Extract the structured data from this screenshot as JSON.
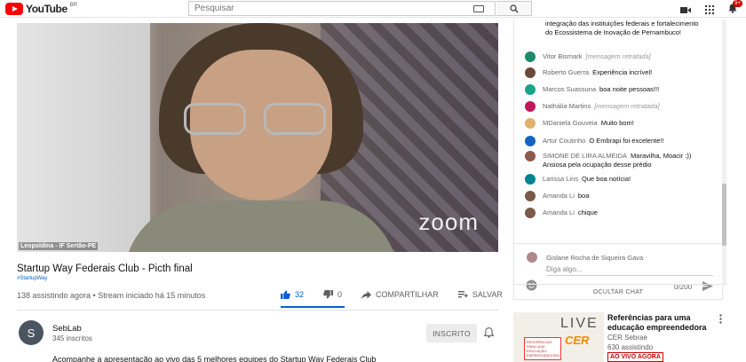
{
  "header": {
    "logo_text": "YouTube",
    "region": "BR",
    "search_placeholder": "Pesquisar",
    "notifications": "9+"
  },
  "video": {
    "speaker": "Leopoldina - IF Sertão-PE",
    "watermark": "zoom",
    "title": "Startup Way Federais Club - Picth final",
    "hashtag": "#StartupWay",
    "meta": "138 assistindo agora • Stream iniciado há 15 minutos",
    "likes": "32",
    "dislikes": "0",
    "like_fraction": 1.0,
    "share_label": "COMPARTILHAR",
    "save_label": "SALVAR"
  },
  "channel": {
    "initial": "S",
    "name": "SebLab",
    "subs": "345 inscritos",
    "subscribe_label": "INSCRITO",
    "description": "Acompanhe a apresentação ao vivo das 5 melhores equipes do Startup Way Federais Club"
  },
  "chat": {
    "first_message": "integração das instituições federais e fortalecimento do Ecossistema de Inovação de Pernambuco!",
    "messages": [
      {
        "author": "Vitor Bismark",
        "text": "[mensagem retratada]",
        "retracted": true,
        "color": "#1e8a6a"
      },
      {
        "author": "Roberto Guerra",
        "text": "Experiência incrível!",
        "retracted": false,
        "color": "#6b4a3a"
      },
      {
        "author": "Marcos Suassuna",
        "text": "boa noite pessoas!!!",
        "retracted": false,
        "color": "#1aa38a"
      },
      {
        "author": "Nathália Martins",
        "text": "[mensagem retratada]",
        "retracted": true,
        "color": "#c2185b"
      },
      {
        "author": "MDaniela Gouveia",
        "text": "Muito bom!",
        "retracted": false,
        "color": "#e0b070"
      },
      {
        "author": "Artur Coutinho",
        "text": "O Embrapi foi excelente!!",
        "retracted": false,
        "color": "#1565c0"
      },
      {
        "author": "SIMONE DE LIRA ALMEIDA",
        "text": "Maravilha, Moacir :)) Ansiosa pela ocupação desse prédio",
        "retracted": false,
        "color": "#8a5a4a"
      },
      {
        "author": "Larissa Lins",
        "text": "Que boa notícia!",
        "retracted": false,
        "color": "#00838f"
      },
      {
        "author": "Amanda Li",
        "text": "boa",
        "retracted": false,
        "color": "#7a5a4a"
      },
      {
        "author": "Amanda Li",
        "text": "chique",
        "retracted": false,
        "color": "#7a5a4a"
      }
    ],
    "composer_name": "Gislane Rocha de Siqueira Gava",
    "composer_placeholder": "Diga algo...",
    "char_count": "0/200",
    "hide_label": "OCULTAR CHAT"
  },
  "recommendation": {
    "thumb_live": "LIVE",
    "thumb_cer": "CER",
    "thumb_book": "REFERÊNCIAS PARA UMA EDUCAÇÃO EMPREENDEDORA",
    "title": "Referências para uma educação empreendedora",
    "channel": "CER Sebrae",
    "viewers": "630 assistindo",
    "live_badge": "AO VIVO AGORA"
  },
  "colors": {
    "brand_red": "#ff0000",
    "like_blue": "#065fd4",
    "live_red": "#cc0000",
    "cer_orange": "#f08a00"
  }
}
